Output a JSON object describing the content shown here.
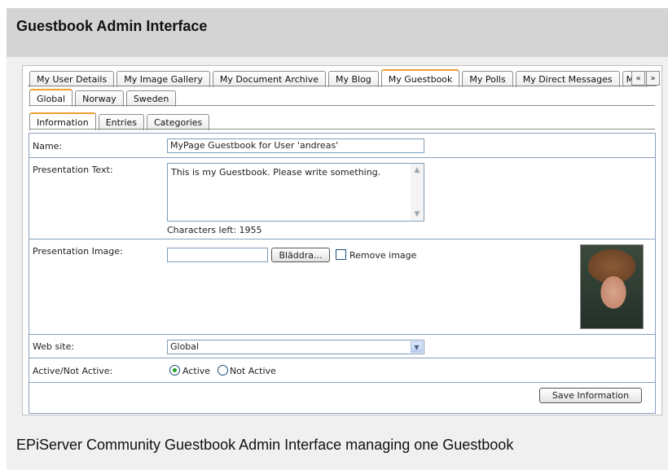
{
  "page": {
    "header_title": "Guestbook Admin Interface",
    "caption": "EPiServer Community Guestbook Admin Interface managing one Guestbook"
  },
  "main_tabs": [
    {
      "label": "My User Details",
      "active": false
    },
    {
      "label": "My Image Gallery",
      "active": false
    },
    {
      "label": "My Document Archive",
      "active": false
    },
    {
      "label": "My Blog",
      "active": false
    },
    {
      "label": "My Guestbook",
      "active": true
    },
    {
      "label": "My Polls",
      "active": false
    },
    {
      "label": "My Direct Messages",
      "active": false
    },
    {
      "label": "My",
      "active": false
    }
  ],
  "tab_scroll": {
    "left": "«",
    "right": "»"
  },
  "site_tabs": [
    {
      "label": "Global",
      "active": true
    },
    {
      "label": "Norway",
      "active": false
    },
    {
      "label": "Sweden",
      "active": false
    }
  ],
  "sub_tabs": [
    {
      "label": "Information",
      "active": true
    },
    {
      "label": "Entries",
      "active": false
    },
    {
      "label": "Categories",
      "active": false
    }
  ],
  "form": {
    "name_label": "Name:",
    "name_value": "MyPage Guestbook for User 'andreas'",
    "presentation_text_label": "Presentation Text:",
    "presentation_text_value": "This is my Guestbook. Please write something.",
    "chars_left": "Characters left: 1955",
    "presentation_image_label": "Presentation Image:",
    "file_value": "",
    "browse_label": "Bläddra...",
    "remove_image_label": "Remove image",
    "remove_image_checked": false,
    "website_label": "Web site:",
    "website_value": "Global",
    "active_label": "Active/Not Active:",
    "active_option": "Active",
    "inactive_option": "Not Active",
    "active_selected": true,
    "save_label": "Save Information"
  },
  "colors": {
    "active_tab_accent": "#f0a030",
    "form_border": "#8aa0c0",
    "radio_dot": "#21a121"
  }
}
